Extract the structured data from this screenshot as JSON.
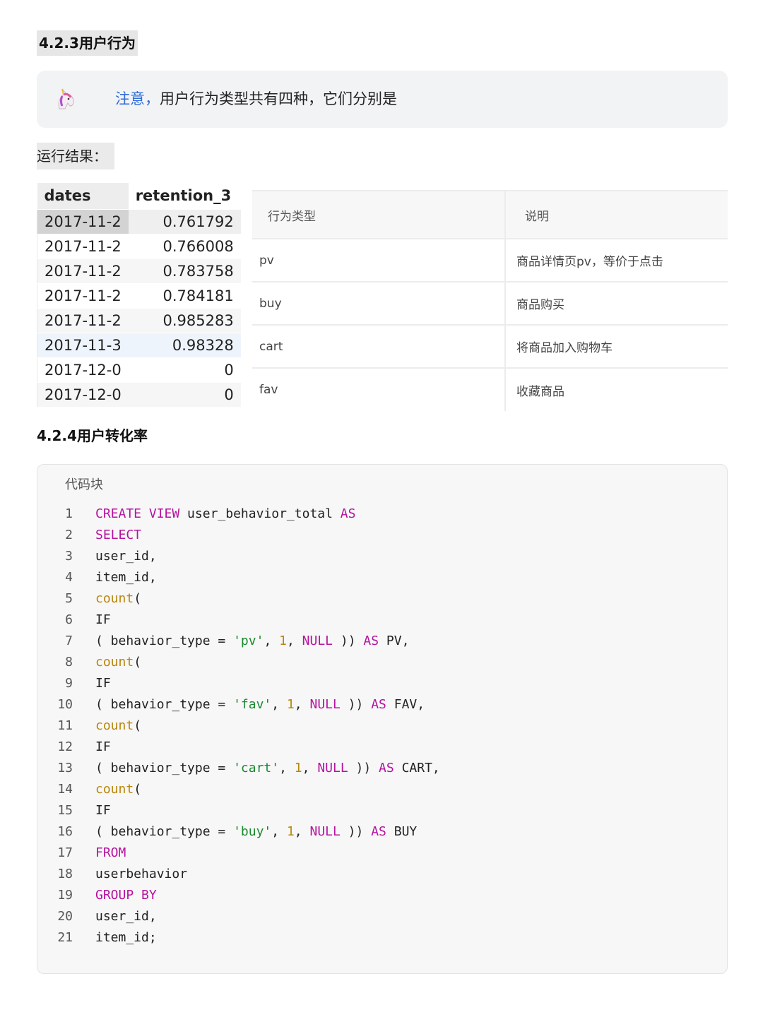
{
  "section1": {
    "title": "4.2.3用户行为"
  },
  "callout": {
    "icon": "unicorn-icon",
    "accent_text": "注意，",
    "text": "用户行为类型共有四种，它们分别是",
    "accent_color": "#2e6bd8"
  },
  "run_result": {
    "label": "运行结果："
  },
  "result_table": {
    "headers": [
      "dates",
      "retention_3"
    ],
    "rows": [
      [
        "2017-11-2",
        "0.761792"
      ],
      [
        "2017-11-2",
        "0.766008"
      ],
      [
        "2017-11-2",
        "0.783758"
      ],
      [
        "2017-11-2",
        "0.784181"
      ],
      [
        "2017-11-2",
        "0.985283"
      ],
      [
        "2017-11-3",
        "0.98328"
      ],
      [
        "2017-12-0",
        "0"
      ],
      [
        "2017-12-0",
        "0"
      ]
    ]
  },
  "behavior_table": {
    "headers": [
      "行为类型",
      "说明"
    ],
    "rows": [
      [
        "pv",
        "商品详情页pv，等价于点击"
      ],
      [
        "buy",
        "商品购买"
      ],
      [
        "cart",
        "将商品加入购物车"
      ],
      [
        "fav",
        "收藏商品"
      ]
    ]
  },
  "section2": {
    "title": "4.2.4用户转化率"
  },
  "code_block": {
    "label": "代码块",
    "lines": [
      [
        [
          "kw",
          "CREATE VIEW"
        ],
        [
          "t",
          " user_behavior_total "
        ],
        [
          "kw",
          "AS"
        ]
      ],
      [
        [
          "kw",
          "SELECT"
        ]
      ],
      [
        [
          "t",
          "user_id,"
        ]
      ],
      [
        [
          "t",
          "item_id,"
        ]
      ],
      [
        [
          "fn",
          "count"
        ],
        [
          "t",
          "("
        ]
      ],
      [
        [
          "t",
          "IF"
        ]
      ],
      [
        [
          "t",
          "( behavior_type = "
        ],
        [
          "str",
          "'pv'"
        ],
        [
          "t",
          ", "
        ],
        [
          "num",
          "1"
        ],
        [
          "t",
          ", "
        ],
        [
          "kw",
          "NULL"
        ],
        [
          "t",
          " )) "
        ],
        [
          "kw",
          "AS"
        ],
        [
          "t",
          " PV,"
        ]
      ],
      [
        [
          "fn",
          "count"
        ],
        [
          "t",
          "("
        ]
      ],
      [
        [
          "t",
          "IF"
        ]
      ],
      [
        [
          "t",
          "( behavior_type = "
        ],
        [
          "str",
          "'fav'"
        ],
        [
          "t",
          ", "
        ],
        [
          "num",
          "1"
        ],
        [
          "t",
          ", "
        ],
        [
          "kw",
          "NULL"
        ],
        [
          "t",
          " )) "
        ],
        [
          "kw",
          "AS"
        ],
        [
          "t",
          " FAV,"
        ]
      ],
      [
        [
          "fn",
          "count"
        ],
        [
          "t",
          "("
        ]
      ],
      [
        [
          "t",
          "IF"
        ]
      ],
      [
        [
          "t",
          "( behavior_type = "
        ],
        [
          "str",
          "'cart'"
        ],
        [
          "t",
          ", "
        ],
        [
          "num",
          "1"
        ],
        [
          "t",
          ", "
        ],
        [
          "kw",
          "NULL"
        ],
        [
          "t",
          " )) "
        ],
        [
          "kw",
          "AS"
        ],
        [
          "t",
          " CART,"
        ]
      ],
      [
        [
          "fn",
          "count"
        ],
        [
          "t",
          "("
        ]
      ],
      [
        [
          "t",
          "IF"
        ]
      ],
      [
        [
          "t",
          "( behavior_type = "
        ],
        [
          "str",
          "'buy'"
        ],
        [
          "t",
          ", "
        ],
        [
          "num",
          "1"
        ],
        [
          "t",
          ", "
        ],
        [
          "kw",
          "NULL"
        ],
        [
          "t",
          " )) "
        ],
        [
          "kw",
          "AS"
        ],
        [
          "t",
          " BUY"
        ]
      ],
      [
        [
          "kw",
          "FROM"
        ]
      ],
      [
        [
          "t",
          "userbehavior"
        ]
      ],
      [
        [
          "kw",
          "GROUP BY"
        ]
      ],
      [
        [
          "t",
          "user_id,"
        ]
      ],
      [
        [
          "t",
          "item_id;"
        ]
      ]
    ]
  }
}
